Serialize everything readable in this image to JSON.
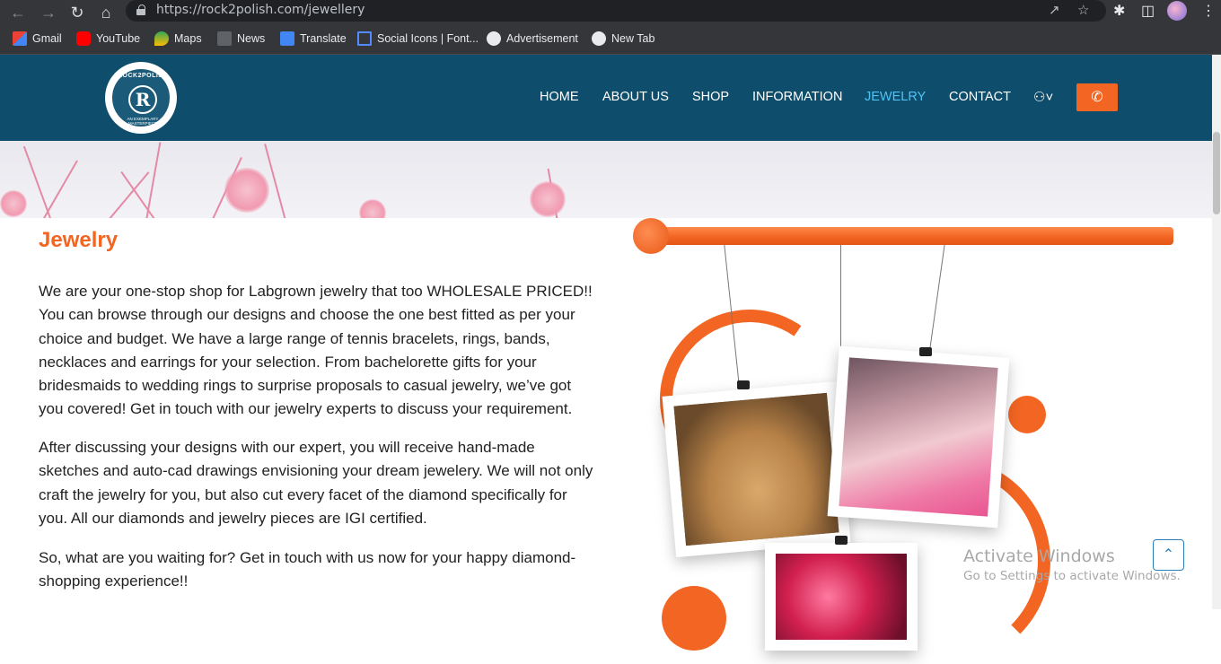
{
  "browser": {
    "url": "https://rock2polish.com/jewellery",
    "bookmarks": [
      "Gmail",
      "YouTube",
      "Maps",
      "News",
      "Translate",
      "Social Icons | Font...",
      "Advertisement",
      "New Tab"
    ]
  },
  "header": {
    "logo_text": "ROCK2POLISH",
    "logo_sub": "AN EXEMPLARY MASTERPIECE",
    "logo_letter": "R",
    "menu": [
      "HOME",
      "ABOUT US",
      "SHOP",
      "INFORMATION",
      "JEWELRY",
      "CONTACT"
    ],
    "active": "JEWELRY"
  },
  "main": {
    "title": "Jewelry",
    "paragraphs": [
      "We are your one-stop shop for Labgrown jewelry that too WHOLESALE PRICED!! You can browse through our designs and choose the one best fitted as per your choice and budget. We have a large range of tennis bracelets, rings, bands, necklaces and earrings for your selection. From bachelorette gifts for your bridesmaids to wedding rings to surprise proposals to casual jewelry, we’ve got you covered! Get in touch with our jewelry experts to discuss your requirement.",
      "After discussing your designs with our expert, you will receive hand-made sketches and auto-cad drawings envisioning your dream jewelery. We will not only craft the jewelry for you, but also cut every facet of the diamond specifically for you. All our diamonds and jewelry pieces are IGI certified.",
      "So, what are you waiting for? Get in touch with us now for your happy diamond-shopping experience!!"
    ]
  },
  "watermark": {
    "title": "Activate Windows",
    "subtitle": "Go to Settings to activate Windows."
  },
  "colors": {
    "header_bg": "#0e4d6b",
    "accent": "#f26522",
    "active_link": "#4fc3f7"
  }
}
